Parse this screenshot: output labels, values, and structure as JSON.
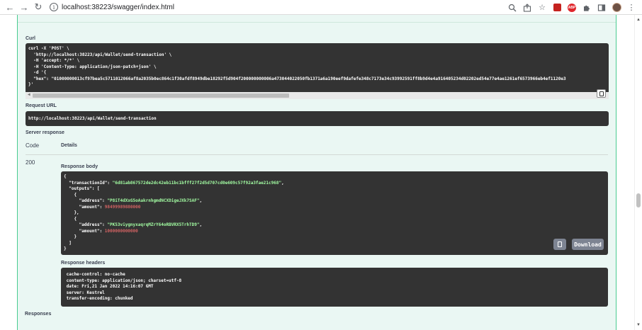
{
  "browser": {
    "url": "localhost:38223/swagger/index.html",
    "back_icon": "arrow-left-icon",
    "forward_icon": "arrow-right-icon",
    "reload_icon": "reload-icon",
    "site_info_icon": "info-icon",
    "right_icons": [
      "zoom-icon",
      "share-icon",
      "star-icon",
      "extension-red-icon",
      "adblock-icon",
      "puzzle-icon",
      "sidebar-icon",
      "avatar",
      "kebab-menu-icon"
    ],
    "abp_label": "ABP"
  },
  "curl": {
    "title": "Curl",
    "lines": [
      "curl -X 'POST' \\",
      "  'http://localhost:38223/api/Wallet/send-transaction' \\",
      "  -H 'accept: */*' \\",
      "  -H 'Content-Type: application/json-patch+json' \\",
      "  -d '{",
      "  \"hex\": \"01000000013cf97bea5c5711012066af8a2035b0ec864c1f30afdf8949dbe18292f5d904f200000000006a473044022050fb1371a6a190eef9dafefe348c7173e34c93992591ff8b9d4e4a916405234d02202ed54e77e4ae1261ef6573966eb4ef1120e3",
      "}'"
    ]
  },
  "request_url": {
    "title": "Request URL",
    "value": "http://localhost:38223/api/Wallet/send-transaction"
  },
  "server_response": {
    "title": "Server response",
    "code_header": "Code",
    "details_header": "Details",
    "code": "200",
    "body_title": "Response body",
    "body": {
      "l1": "{",
      "tx_key": "  \"transactionId\": ",
      "tx_val": "\"6d81ab867572de2dc42eb11bc1bfff27f2d5d707cd0e609c57f92a3fae21c968\"",
      "tx_end": ",",
      "outputs_key": "  \"outputs\": [",
      "ob1": "    {",
      "addr_key": "      \"address\": ",
      "addr1_val": "\"P8iT4dXxG5oAakrnhgmdNCXDigeJXk7SAF\"",
      "amount_key": "      \"amount\": ",
      "amount1_val": "98499989880000",
      "ob1_end": "    },",
      "ob2": "    {",
      "addr2_val": "\"PK53viygnyxaqrqMZrY64oRBVRX5TrhTD9\"",
      "amount2_val": "1000000000000",
      "ob2_end": "    }",
      "arr_end": "  ]",
      "l_end": "}"
    },
    "download_label": "Download",
    "headers_title": "Response headers",
    "headers": [
      " cache-control: no-cache",
      " content-type: application/json; charset=utf-8",
      " date: Fri,21 Jan 2022 14:16:07 GMT",
      " server: Kestrel",
      " transfer-encoding: chunked"
    ]
  },
  "responses_title": "Responses",
  "colors": {
    "opblock_bg": "#eaf7f3",
    "opblock_border": "#49cc90",
    "code_bg": "#333333",
    "string_color": "#a2fca2",
    "number_color": "#d36363",
    "button_bg": "#7d8492"
  }
}
